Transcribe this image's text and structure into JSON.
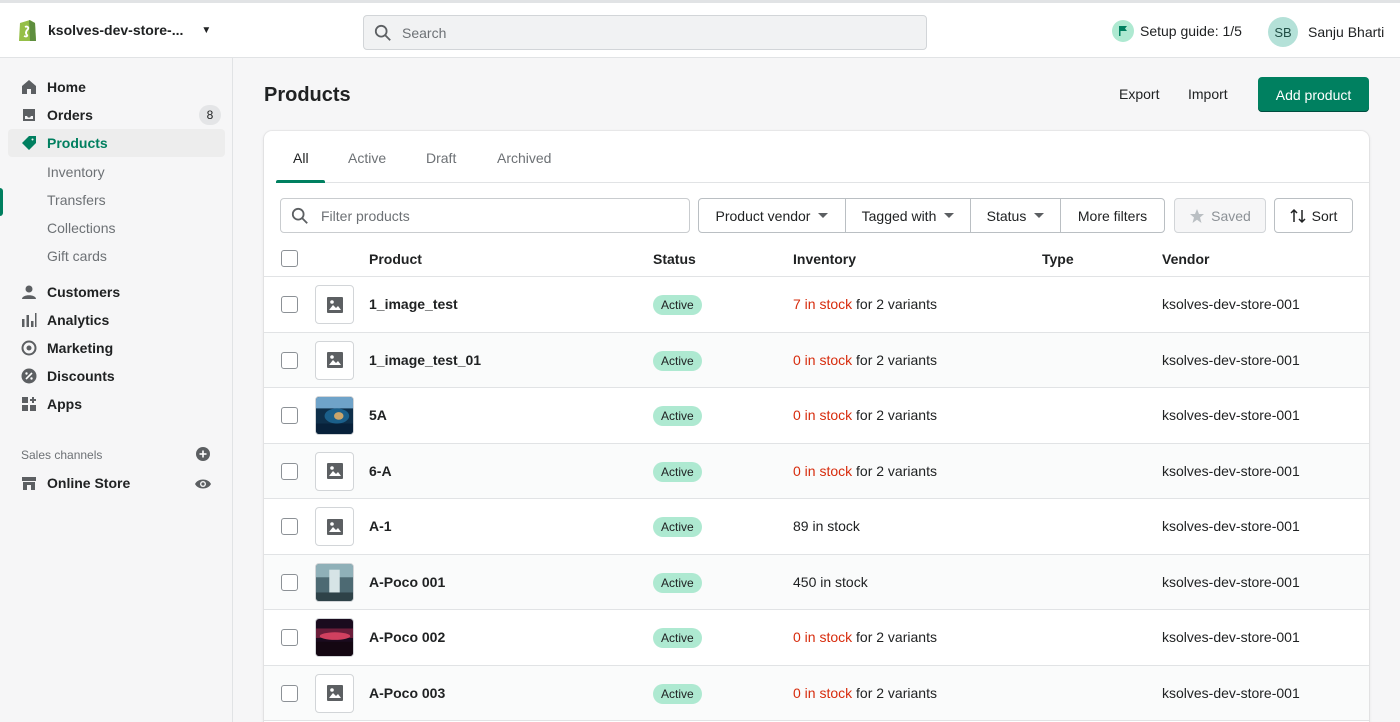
{
  "topbar": {
    "store_name": "ksolves-dev-store-...",
    "search_placeholder": "Search",
    "setup_guide": "Setup guide: 1/5",
    "user_initials": "SB",
    "user_name": "Sanju Bharti"
  },
  "sidebar": {
    "items": [
      {
        "label": "Home",
        "icon": "home-icon"
      },
      {
        "label": "Orders",
        "icon": "orders-icon",
        "badge": "8"
      },
      {
        "label": "Products",
        "icon": "tag-icon",
        "active": true
      },
      {
        "label": "Customers",
        "icon": "person-icon"
      },
      {
        "label": "Analytics",
        "icon": "bar-chart-icon"
      },
      {
        "label": "Marketing",
        "icon": "target-icon"
      },
      {
        "label": "Discounts",
        "icon": "discount-icon"
      },
      {
        "label": "Apps",
        "icon": "apps-icon"
      }
    ],
    "sub_items": [
      "Inventory",
      "Transfers",
      "Collections",
      "Gift cards"
    ],
    "sales_channels_label": "Sales channels",
    "online_store": "Online Store"
  },
  "page": {
    "title": "Products",
    "export": "Export",
    "import": "Import",
    "add_product": "Add product"
  },
  "tabs": [
    "All",
    "Active",
    "Draft",
    "Archived"
  ],
  "filters": {
    "placeholder": "Filter products",
    "product_vendor": "Product vendor",
    "tagged_with": "Tagged with",
    "status": "Status",
    "more_filters": "More filters",
    "saved": "Saved",
    "sort": "Sort"
  },
  "table": {
    "columns": [
      "Product",
      "Status",
      "Inventory",
      "Type",
      "Vendor"
    ],
    "rows": [
      {
        "name": "1_image_test",
        "status": "Active",
        "stock": "7 in stock",
        "variants": " for 2 variants",
        "stock_red": true,
        "type": "",
        "vendor": "ksolves-dev-store-001",
        "thumb": "placeholder"
      },
      {
        "name": "1_image_test_01",
        "status": "Active",
        "stock": "0 in stock",
        "variants": " for 2 variants",
        "stock_red": true,
        "type": "",
        "vendor": "ksolves-dev-store-001",
        "thumb": "placeholder"
      },
      {
        "name": "5A",
        "status": "Active",
        "stock": "0 in stock",
        "variants": " for 2 variants",
        "stock_red": true,
        "type": "",
        "vendor": "ksolves-dev-store-001",
        "thumb": "photo-ocean"
      },
      {
        "name": "6-A",
        "status": "Active",
        "stock": "0 in stock",
        "variants": " for 2 variants",
        "stock_red": true,
        "type": "",
        "vendor": "ksolves-dev-store-001",
        "thumb": "placeholder"
      },
      {
        "name": "A-1",
        "status": "Active",
        "stock": "89 in stock",
        "variants": "",
        "stock_red": false,
        "type": "",
        "vendor": "ksolves-dev-store-001",
        "thumb": "placeholder"
      },
      {
        "name": "A-Poco 001",
        "status": "Active",
        "stock": "450 in stock",
        "variants": "",
        "stock_red": false,
        "type": "",
        "vendor": "ksolves-dev-store-001",
        "thumb": "photo-waterfall"
      },
      {
        "name": "A-Poco 002",
        "status": "Active",
        "stock": "0 in stock",
        "variants": " for 2 variants",
        "stock_red": true,
        "type": "",
        "vendor": "ksolves-dev-store-001",
        "thumb": "photo-sunset"
      },
      {
        "name": "A-Poco 003",
        "status": "Active",
        "stock": "0 in stock",
        "variants": " for 2 variants",
        "stock_red": true,
        "type": "",
        "vendor": "ksolves-dev-store-001",
        "thumb": "placeholder"
      }
    ]
  },
  "colors": {
    "primary": "#008060",
    "active_nav": "#007f5f",
    "status_badge": "#aee9d1",
    "stock_red": "#d72c0d"
  }
}
